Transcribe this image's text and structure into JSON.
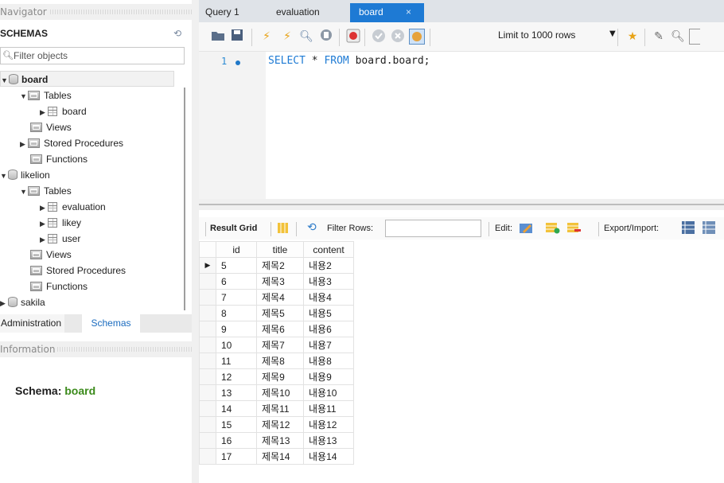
{
  "navigator": {
    "header": "Navigator",
    "schemas_title": "SCHEMAS",
    "filter_placeholder": "Filter objects",
    "tree": [
      {
        "label": "board",
        "type": "schema",
        "expanded": true,
        "selected": true
      },
      {
        "label": "Tables",
        "type": "folder",
        "expanded": true
      },
      {
        "label": "board",
        "type": "table"
      },
      {
        "label": "Views",
        "type": "folder"
      },
      {
        "label": "Stored Procedures",
        "type": "folder"
      },
      {
        "label": "Functions",
        "type": "folder"
      },
      {
        "label": "likelion",
        "type": "schema",
        "expanded": true
      },
      {
        "label": "Tables",
        "type": "folder",
        "expanded": true
      },
      {
        "label": "evaluation",
        "type": "table"
      },
      {
        "label": "likey",
        "type": "table"
      },
      {
        "label": "user",
        "type": "table"
      },
      {
        "label": "Views",
        "type": "folder"
      },
      {
        "label": "Stored Procedures",
        "type": "folder"
      },
      {
        "label": "Functions",
        "type": "folder"
      },
      {
        "label": "sakila",
        "type": "schema",
        "expanded": false
      }
    ],
    "bottom_tabs": {
      "administration": "Administration",
      "schemas": "Schemas"
    },
    "info_header": "Information",
    "schema_info": {
      "label": "Schema:",
      "value": "board"
    }
  },
  "editor": {
    "tabs": [
      {
        "label": "Query 1"
      },
      {
        "label": "evaluation"
      },
      {
        "label": "board",
        "active": true
      }
    ],
    "close_glyph": "×",
    "limit_label": "Limit to 1000 rows",
    "line_number": "1",
    "sql": {
      "kw1": "SELECT",
      "star": " * ",
      "kw2": "FROM",
      "rest": " board.board;"
    }
  },
  "result_toolbar": {
    "result_grid": "Result Grid",
    "filter_rows": "Filter Rows:",
    "edit": "Edit:",
    "export_import": "Export/Import:"
  },
  "grid": {
    "columns": [
      "id",
      "title",
      "content"
    ],
    "rows": [
      [
        "5",
        "제목2",
        "내용2"
      ],
      [
        "6",
        "제목3",
        "내용3"
      ],
      [
        "7",
        "제목4",
        "내용4"
      ],
      [
        "8",
        "제목5",
        "내용5"
      ],
      [
        "9",
        "제목6",
        "내용6"
      ],
      [
        "10",
        "제목7",
        "내용7"
      ],
      [
        "11",
        "제목8",
        "내용8"
      ],
      [
        "12",
        "제목9",
        "내용9"
      ],
      [
        "13",
        "제목10",
        "내용10"
      ],
      [
        "14",
        "제목11",
        "내용11"
      ],
      [
        "15",
        "제목12",
        "내용12"
      ],
      [
        "16",
        "제목13",
        "내용13"
      ],
      [
        "17",
        "제목14",
        "내용14"
      ]
    ]
  },
  "colors": {
    "accent": "#1e7ad4",
    "schema_value": "#3b8a1b",
    "sql_keyword": "#1f7bd4"
  }
}
